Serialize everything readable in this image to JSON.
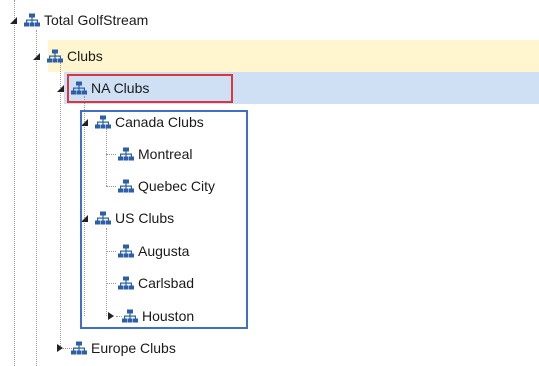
{
  "tree": {
    "nodes": [
      {
        "id": "total-golfstream",
        "label": "Total GolfStream",
        "state": "expanded"
      },
      {
        "id": "clubs",
        "label": "Clubs",
        "state": "expanded"
      },
      {
        "id": "na-clubs",
        "label": "NA Clubs",
        "state": "expanded"
      },
      {
        "id": "canada-clubs",
        "label": "Canada Clubs",
        "state": "expanded"
      },
      {
        "id": "montreal",
        "label": "Montreal",
        "state": "leaf"
      },
      {
        "id": "quebec-city",
        "label": "Quebec City",
        "state": "leaf"
      },
      {
        "id": "us-clubs",
        "label": "US Clubs",
        "state": "expanded"
      },
      {
        "id": "augusta",
        "label": "Augusta",
        "state": "leaf"
      },
      {
        "id": "carlsbad",
        "label": "Carlsbad",
        "state": "leaf"
      },
      {
        "id": "houston",
        "label": "Houston",
        "state": "collapsed"
      },
      {
        "id": "europe-clubs",
        "label": "Europe Clubs",
        "state": "collapsed"
      }
    ]
  },
  "icons": {
    "node_icon": "org-hierarchy-icon",
    "expanded_icon": "triangle-expanded-icon",
    "collapsed_icon": "triangle-collapsed-icon"
  },
  "colors": {
    "selected_row": "#cfe0f5",
    "hover_row": "#fff6cf",
    "icon": "#2b5fa8",
    "annotation_red": "#d9363e",
    "annotation_blue": "#3f6fc6"
  }
}
